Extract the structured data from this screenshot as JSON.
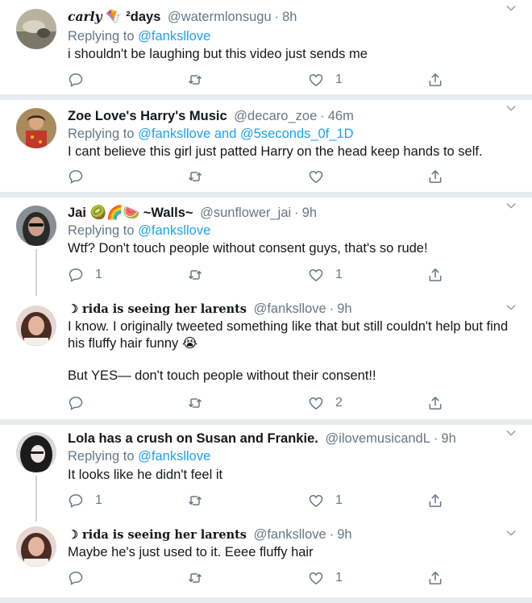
{
  "tweets": [
    {
      "name": "carly",
      "name_suffix": "²days",
      "handle": "@watermlonsugu",
      "time": "8h",
      "replying_prefix": "Replying to",
      "replying_to": "@fanksllove",
      "replying_and": "",
      "replying_to2": "",
      "text": [
        "i shouldn't be laughing but this video just sends me"
      ],
      "replies": "",
      "retweets": "",
      "likes": "1"
    },
    {
      "name": "Zoe Love's Harry's Music",
      "handle": "@decaro_zoe",
      "time": "46m",
      "replying_prefix": "Replying to",
      "replying_to": "@fanksllove",
      "replying_and": "and",
      "replying_to2": "@5seconds_0f_1D",
      "text": [
        "I cant believe this girl just patted Harry on the head keep hands to self."
      ],
      "replies": "",
      "retweets": "",
      "likes": ""
    },
    {
      "name": "Jai",
      "name_suffix": "~Walls~",
      "handle": "@sunflower_jai",
      "time": "9h",
      "replying_prefix": "Replying to",
      "replying_to": "@fanksllove",
      "text": [
        "Wtf? Don't touch people without consent guys, that's so rude!"
      ],
      "replies": "1",
      "retweets": "",
      "likes": "1"
    },
    {
      "name": "☽ rida is seeing her larents",
      "handle": "@fanksllove",
      "time": "9h",
      "text": [
        "I know. I originally tweeted something like that but still couldn't help but find his fluffy hair funny 😭",
        "But YES— don't touch people without their consent!!"
      ],
      "replies": "",
      "retweets": "",
      "likes": "2"
    },
    {
      "name": "Lola has a crush on Susan and Frankie.",
      "handle": "@ilovemusicandL",
      "time": "9h",
      "replying_prefix": "Replying to",
      "replying_to": "@fanksllove",
      "text": [
        "It looks like he didn't feel it"
      ],
      "replies": "1",
      "retweets": "",
      "likes": "1"
    },
    {
      "name": "☽ rida is seeing her larents",
      "handle": "@fanksllove",
      "time": "9h",
      "text": [
        "Maybe he's just used to it. Eeee fluffy hair"
      ],
      "replies": "",
      "retweets": "",
      "likes": "1"
    }
  ],
  "colors": {
    "link": "#1da1f2",
    "muted": "#657786",
    "text": "#14171a",
    "divider": "#e6ecf0"
  },
  "icons": [
    "reply-icon",
    "retweet-icon",
    "like-icon",
    "share-icon",
    "chevron-down-icon"
  ]
}
